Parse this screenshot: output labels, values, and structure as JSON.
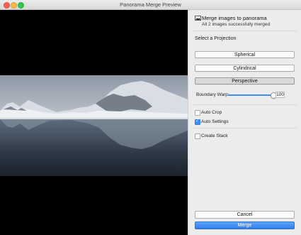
{
  "window": {
    "title": "Panorama Merge Preview"
  },
  "header": {
    "title": "Merge images to panorama",
    "subtitle": "All 2 images successfully merged"
  },
  "projection": {
    "label": "Select a Projection",
    "options": [
      "Spherical",
      "Cylindrical",
      "Perspective"
    ],
    "selected": "Perspective"
  },
  "boundary_warp": {
    "label": "Boundary Warp:",
    "value": "100",
    "level": 1.0
  },
  "options": {
    "auto_crop": {
      "label": "Auto Crop",
      "checked": false
    },
    "auto_settings": {
      "label": "Auto Settings",
      "checked": true
    },
    "create_stack": {
      "label": "Create Stack",
      "checked": false
    }
  },
  "buttons": {
    "cancel": "Cancel",
    "merge": "Merge"
  },
  "colors": {
    "accent": "#3d8ef7",
    "merge_button": "#2f7de8",
    "preview_bg": "#000000"
  }
}
